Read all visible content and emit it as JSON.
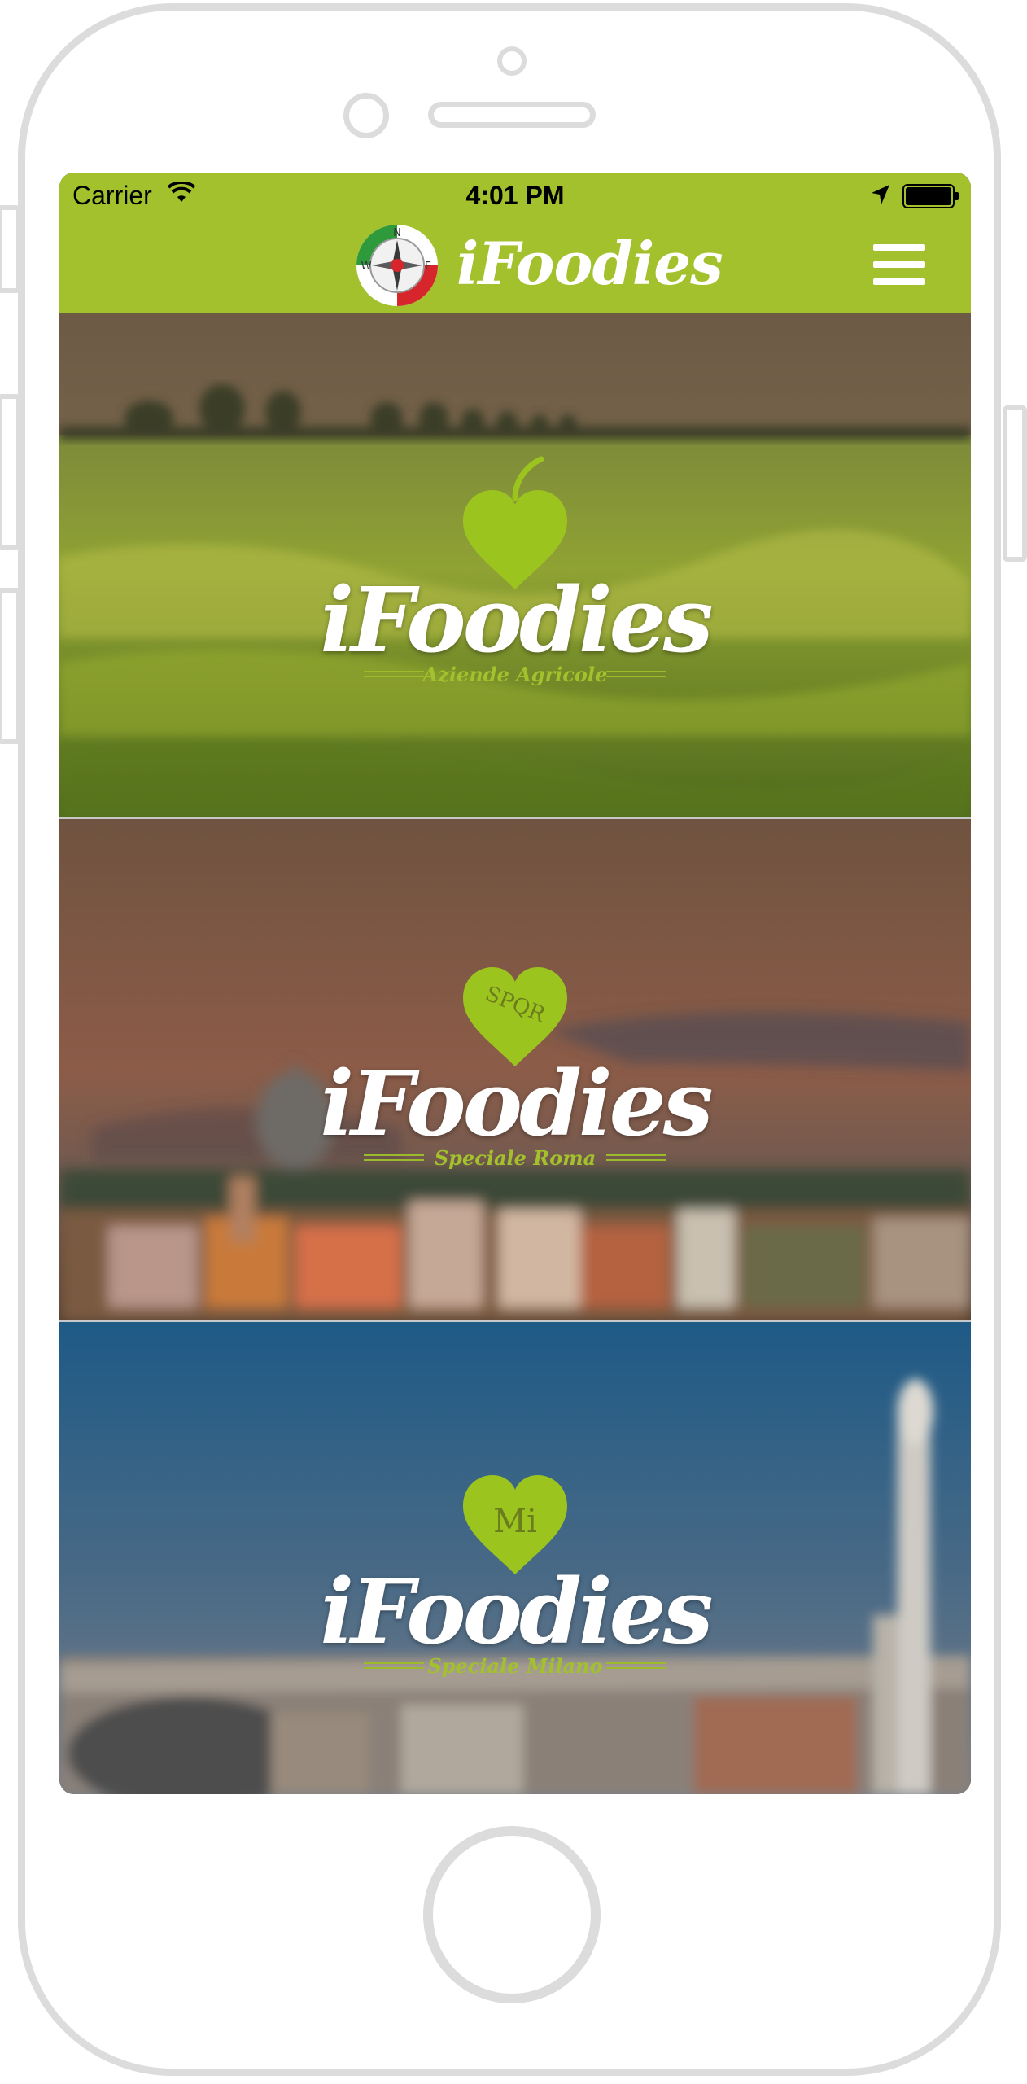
{
  "status_bar": {
    "carrier": "Carrier",
    "time": "4:01 PM",
    "icons": [
      "wifi-icon",
      "location-arrow-icon",
      "battery-icon"
    ]
  },
  "nav_bar": {
    "logo": "compass-logo-icon",
    "title": "iFoodies",
    "menu": "hamburger-menu-icon"
  },
  "colors": {
    "accent": "#a2c12c",
    "heart": "#9cc41f",
    "frame": "#dcdcdc"
  },
  "cards": [
    {
      "brand": "iFoodies",
      "tagline": "Aziende Agricole",
      "heart_icon": "leaf-heart-icon",
      "heart_text": ""
    },
    {
      "brand": "iFoodies",
      "tagline": "Speciale Roma",
      "heart_icon": "spqr-heart-icon",
      "heart_text": "SPQR"
    },
    {
      "brand": "iFoodies",
      "tagline": "Speciale Milano",
      "heart_icon": "mi-heart-icon",
      "heart_text": "Mi"
    }
  ]
}
